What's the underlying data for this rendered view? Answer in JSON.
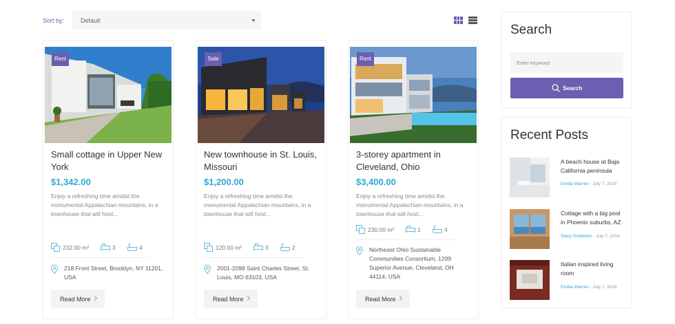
{
  "toolbar": {
    "sort_label": "Sort by:",
    "sort_value": "Default"
  },
  "listings": [
    {
      "badge": "Rent",
      "title": "Small cottage in Upper New York",
      "price": "$1,342.00",
      "description": "Enjoy a refreshing time amidst the monumental Appalachian mountains, in a townhouse that will host...",
      "area": "232.00 m²",
      "beds": "3",
      "baths": "4",
      "address": "218 Front Street, Brooklyn, NY 11201, USA",
      "read_more": "Read More"
    },
    {
      "badge": "Sale",
      "title": "New townhouse in St. Louis, Missouri",
      "price": "$1,200.00",
      "description": "Enjoy a refreshing time amidst the monumental Appalachian mountains, in a townhouse that will host...",
      "area": "120.00 m²",
      "beds": "3",
      "baths": "2",
      "address": "2001-2099 Saint Charles Street, St. Louis, MO 63103, USA",
      "read_more": "Read More"
    },
    {
      "badge": "Rent",
      "title": "3-storey apartment in Cleveland, Ohio",
      "price": "$3,400.00",
      "description": "Enjoy a refreshing time amidst the monumental Appalachian mountains, in a townhouse that will host...",
      "area": "230.00 m²",
      "beds": "1",
      "baths": "4",
      "address": "Northeast Ohio Sustainable Communities Consortium, 1299 Superior Avenue, Cleveland, OH 44114, USA",
      "read_more": "Read More"
    }
  ],
  "search_widget": {
    "title": "Search",
    "placeholder": "Enter keyword",
    "button_label": "Search"
  },
  "recent_posts": {
    "title": "Recent Posts",
    "items": [
      {
        "title": "A beach house at Baja California peninsula",
        "author": "Emilia Warren",
        "date": "- July 7, 2016"
      },
      {
        "title": "Cottage with a big pool in Phoenix suburbs, AZ",
        "author": "Stacy Goldwein",
        "date": "- July 7, 2016"
      },
      {
        "title": "Italian inspired living room",
        "author": "Emilia Warren",
        "date": "- July 7, 2016"
      }
    ]
  },
  "colors": {
    "accent": "#6a5fb0",
    "price": "#2ea7d8",
    "link": "#2ea7d8"
  }
}
